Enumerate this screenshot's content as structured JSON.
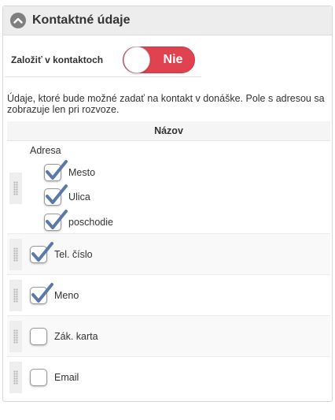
{
  "panel": {
    "title": "Kontaktné údaje",
    "collapse_icon": "chevron-up-icon"
  },
  "toggle": {
    "label": "Založiť v kontaktoch",
    "state_text": "Nie",
    "on": false,
    "color": "#e0434f"
  },
  "description": "Údaje, ktoré bude možné zadať na kontakt v donáške. Pole s adresou sa zobrazuje len pri rozvoze.",
  "table": {
    "header": "Názov",
    "address_group": {
      "label": "Adresa",
      "items": [
        {
          "label": "Mesto",
          "checked": true
        },
        {
          "label": "Ulica",
          "checked": true
        },
        {
          "label": "poschodie",
          "checked": true
        }
      ]
    },
    "rows": [
      {
        "label": "Tel. číslo",
        "checked": true
      },
      {
        "label": "Meno",
        "checked": true
      },
      {
        "label": "Zák. karta",
        "checked": false
      },
      {
        "label": "Email",
        "checked": false
      }
    ]
  },
  "colors": {
    "check": "#5b79a8",
    "switch_off": "#e0434f"
  }
}
